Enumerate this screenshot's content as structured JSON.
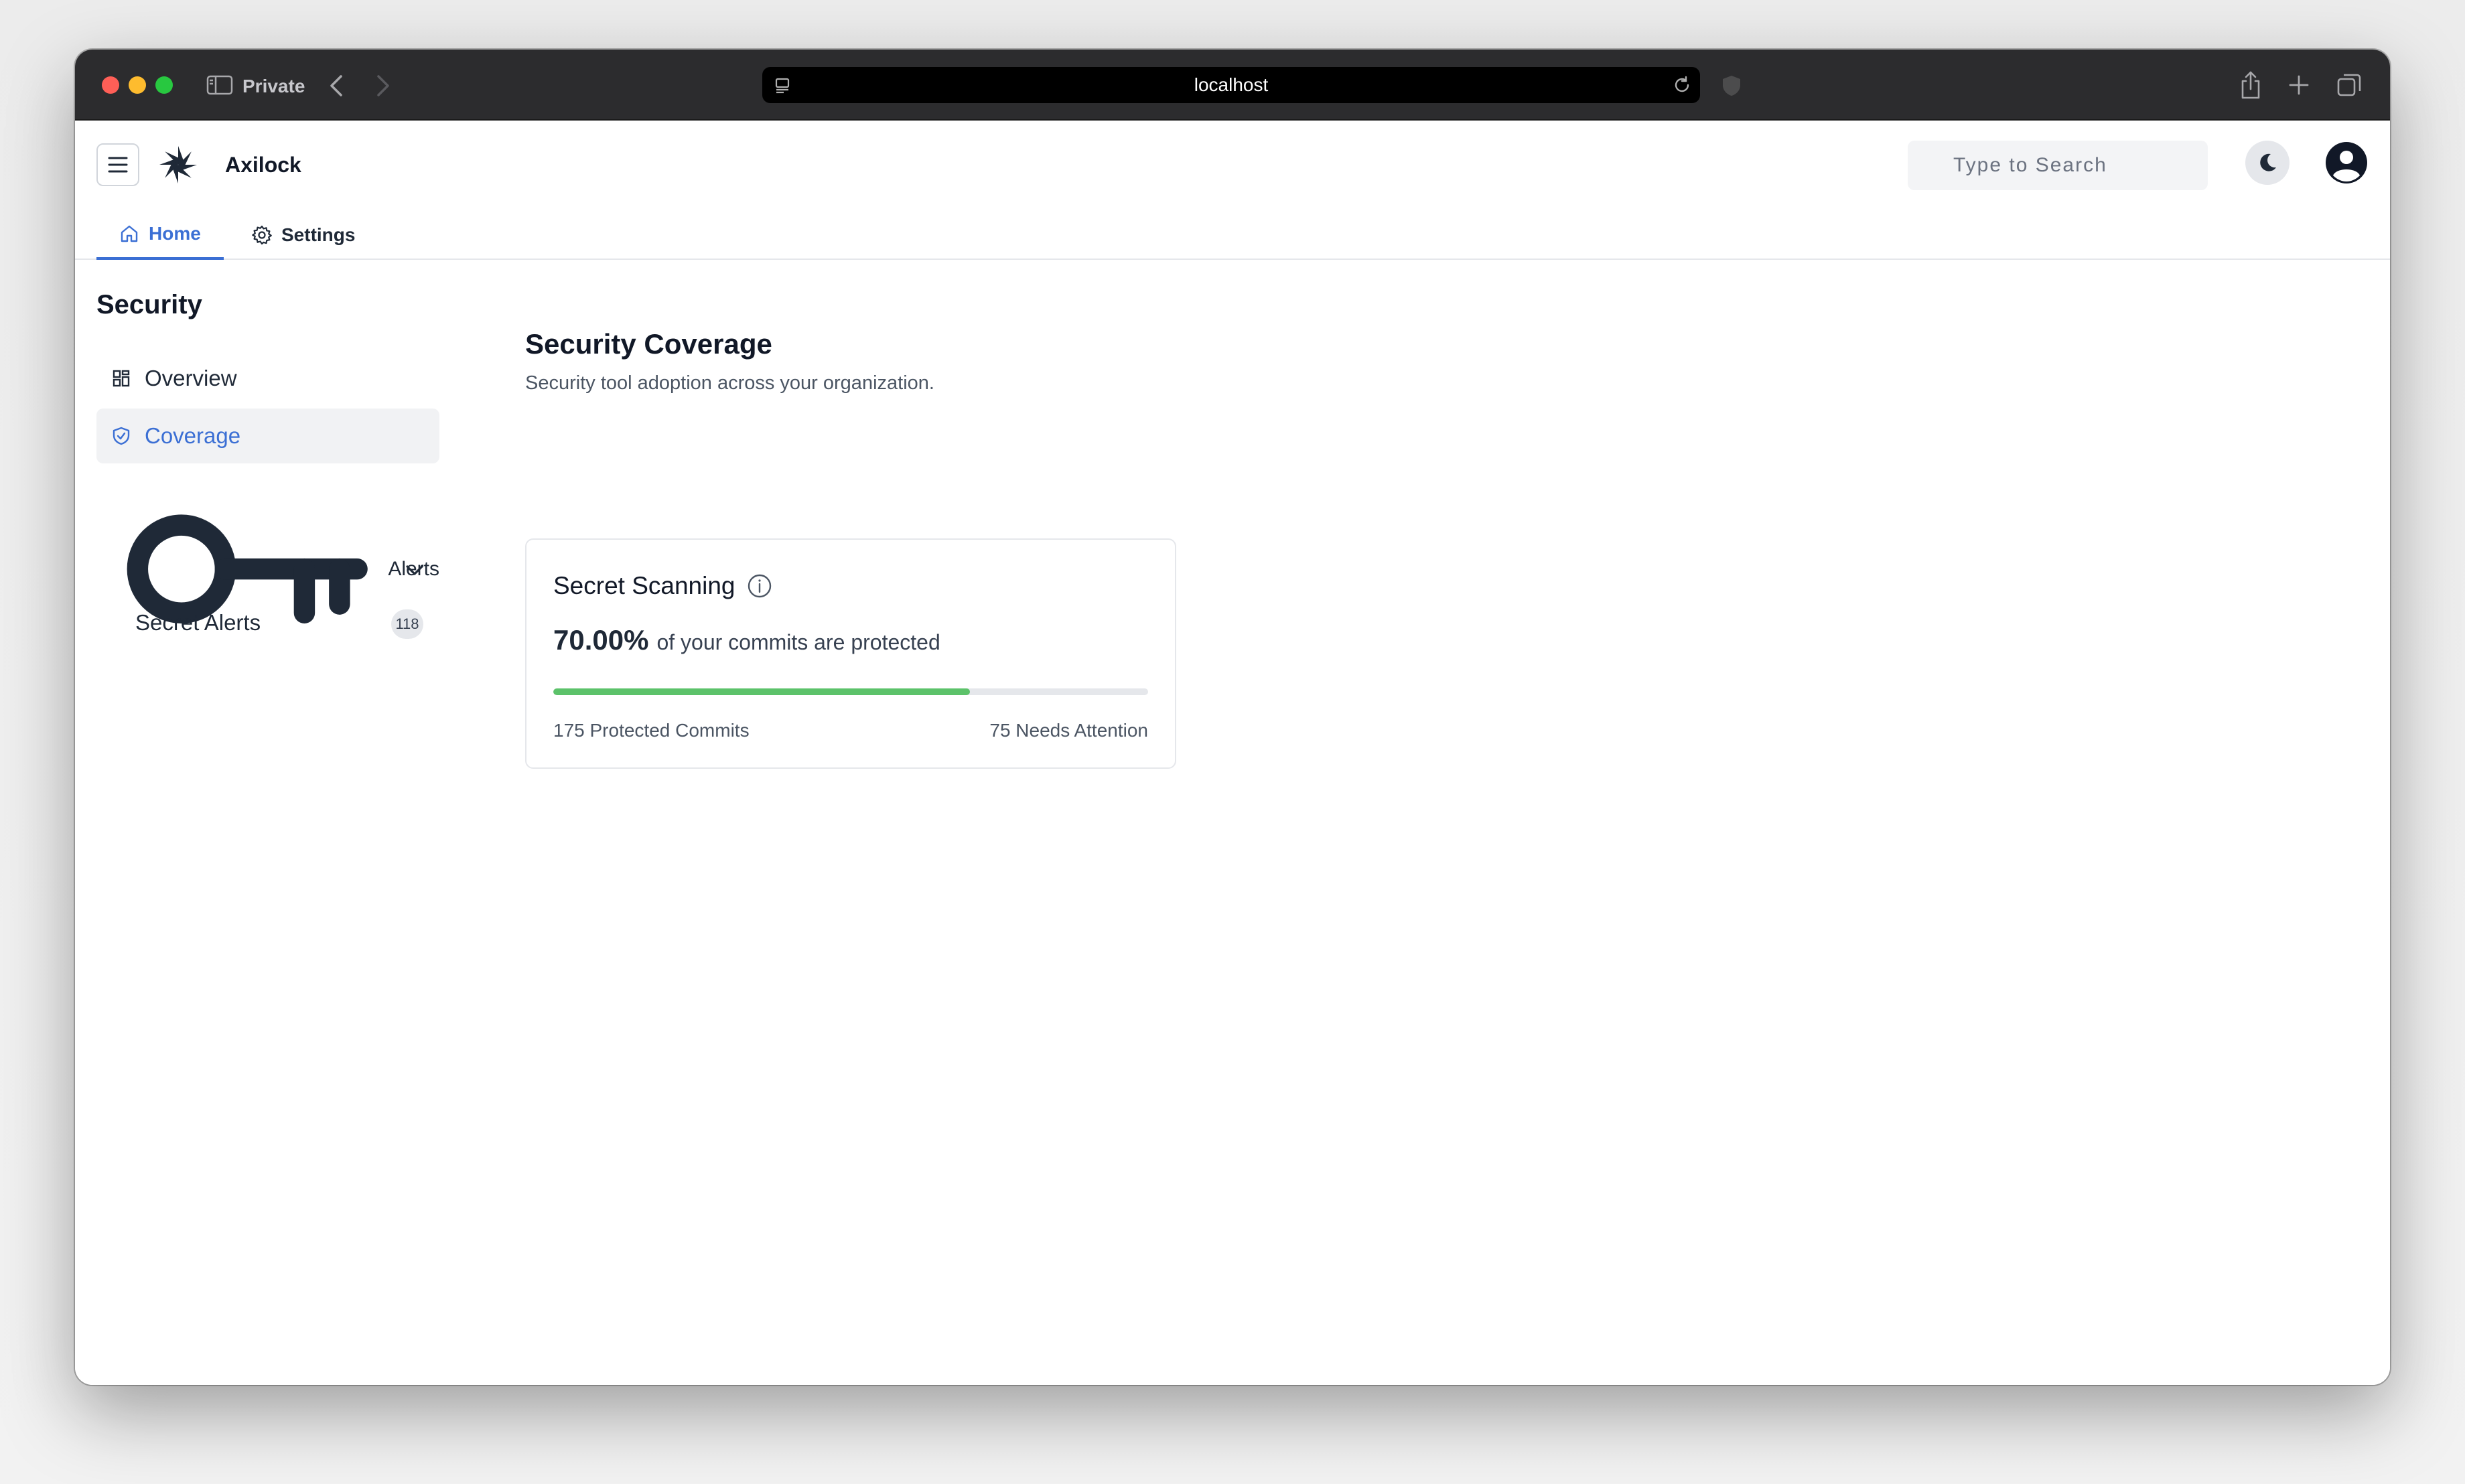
{
  "browser": {
    "mode_label": "Private",
    "url": "localhost"
  },
  "app": {
    "name": "Axilock",
    "search_placeholder": "Type to Search",
    "tabs": [
      {
        "label": "Home",
        "active": true
      },
      {
        "label": "Settings",
        "active": false
      }
    ]
  },
  "sidebar": {
    "title": "Security",
    "items": [
      {
        "label": "Overview",
        "icon": "grid-icon"
      },
      {
        "label": "Coverage",
        "icon": "shield-check-icon",
        "active": true
      }
    ],
    "group": {
      "label": "Alerts",
      "icon": "key-icon",
      "children": [
        {
          "label": "Secret Alerts",
          "count": "118"
        }
      ]
    }
  },
  "main": {
    "title": "Security Coverage",
    "subtitle": "Security tool adoption across your organization.",
    "card": {
      "title": "Secret Scanning",
      "percent": "70.00%",
      "percent_label": "of your commits are protected",
      "progress": 0.7,
      "protected_label": "175 Protected Commits",
      "attention_label": "75 Needs Attention"
    }
  },
  "colors": {
    "accent": "#3b6fd4",
    "progress": "#5cc26a"
  }
}
